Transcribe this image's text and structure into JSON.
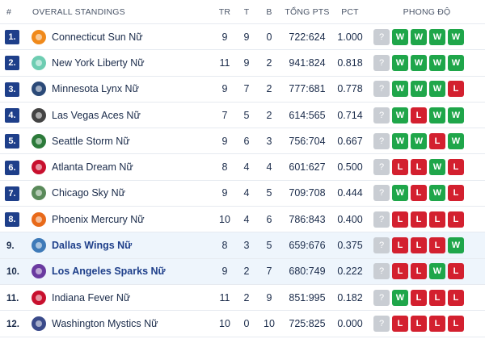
{
  "header": {
    "rank": "#",
    "standings": "OVERALL STANDINGS",
    "tr": "TR",
    "t": "T",
    "b": "B",
    "pts": "TỔNG PTS",
    "pct": "PCT",
    "form": "PHONG ĐỘ"
  },
  "colors": {
    "accent": "#1e3f8a",
    "win": "#1fa64a",
    "loss": "#d3202f",
    "unknown": "#c9cdd3",
    "highlight_row": "#eef5fc"
  },
  "rows": [
    {
      "rank": "1.",
      "team": "Connecticut Sun Nữ",
      "tr": "9",
      "t": "9",
      "b": "0",
      "pts": "722:624",
      "pct": "1.000",
      "form": [
        "?",
        "W",
        "W",
        "W",
        "W"
      ],
      "logo": "connecticut-sun-logo",
      "logo_color": "#f08a1c",
      "highlighted": false
    },
    {
      "rank": "2.",
      "team": "New York Liberty Nữ",
      "tr": "11",
      "t": "9",
      "b": "2",
      "pts": "941:824",
      "pct": "0.818",
      "form": [
        "?",
        "W",
        "W",
        "W",
        "W"
      ],
      "logo": "new-york-liberty-logo",
      "logo_color": "#6ecdb2",
      "highlighted": false
    },
    {
      "rank": "3.",
      "team": "Minnesota Lynx Nữ",
      "tr": "9",
      "t": "7",
      "b": "2",
      "pts": "777:681",
      "pct": "0.778",
      "form": [
        "?",
        "W",
        "W",
        "W",
        "L"
      ],
      "logo": "minnesota-lynx-logo",
      "logo_color": "#2b4a78",
      "highlighted": false
    },
    {
      "rank": "4.",
      "team": "Las Vegas Aces Nữ",
      "tr": "7",
      "t": "5",
      "b": "2",
      "pts": "614:565",
      "pct": "0.714",
      "form": [
        "?",
        "W",
        "L",
        "W",
        "W"
      ],
      "logo": "las-vegas-aces-logo",
      "logo_color": "#444444",
      "highlighted": false
    },
    {
      "rank": "5.",
      "team": "Seattle Storm Nữ",
      "tr": "9",
      "t": "6",
      "b": "3",
      "pts": "756:704",
      "pct": "0.667",
      "form": [
        "?",
        "W",
        "W",
        "L",
        "W"
      ],
      "logo": "seattle-storm-logo",
      "logo_color": "#2c7a3a",
      "highlighted": false
    },
    {
      "rank": "6.",
      "team": "Atlanta Dream Nữ",
      "tr": "8",
      "t": "4",
      "b": "4",
      "pts": "601:627",
      "pct": "0.500",
      "form": [
        "?",
        "L",
        "L",
        "W",
        "L"
      ],
      "logo": "atlanta-dream-logo",
      "logo_color": "#c8102e",
      "highlighted": false
    },
    {
      "rank": "7.",
      "team": "Chicago Sky Nữ",
      "tr": "9",
      "t": "4",
      "b": "5",
      "pts": "709:708",
      "pct": "0.444",
      "form": [
        "?",
        "W",
        "L",
        "W",
        "L"
      ],
      "logo": "chicago-sky-logo",
      "logo_color": "#5a8a5a",
      "highlighted": false
    },
    {
      "rank": "8.",
      "team": "Phoenix Mercury Nữ",
      "tr": "10",
      "t": "4",
      "b": "6",
      "pts": "786:843",
      "pct": "0.400",
      "form": [
        "?",
        "L",
        "L",
        "L",
        "L"
      ],
      "logo": "phoenix-mercury-logo",
      "logo_color": "#e86a1a",
      "highlighted": false
    },
    {
      "rank": "9.",
      "team": "Dallas Wings Nữ",
      "tr": "8",
      "t": "3",
      "b": "5",
      "pts": "659:676",
      "pct": "0.375",
      "form": [
        "?",
        "L",
        "L",
        "L",
        "W"
      ],
      "logo": "dallas-wings-logo",
      "logo_color": "#3e7ab8",
      "highlighted": true
    },
    {
      "rank": "10.",
      "team": "Los Angeles Sparks Nữ",
      "tr": "9",
      "t": "2",
      "b": "7",
      "pts": "680:749",
      "pct": "0.222",
      "form": [
        "?",
        "L",
        "L",
        "W",
        "L"
      ],
      "logo": "los-angeles-sparks-logo",
      "logo_color": "#6a3aa0",
      "highlighted": true
    },
    {
      "rank": "11.",
      "team": "Indiana Fever Nữ",
      "tr": "11",
      "t": "2",
      "b": "9",
      "pts": "851:995",
      "pct": "0.182",
      "form": [
        "?",
        "W",
        "L",
        "L",
        "L"
      ],
      "logo": "indiana-fever-logo",
      "logo_color": "#c8102e",
      "highlighted": false
    },
    {
      "rank": "12.",
      "team": "Washington Mystics Nữ",
      "tr": "10",
      "t": "0",
      "b": "10",
      "pts": "725:825",
      "pct": "0.000",
      "form": [
        "?",
        "L",
        "L",
        "L",
        "L"
      ],
      "logo": "washington-mystics-logo",
      "logo_color": "#3a4a8a",
      "highlighted": false
    }
  ]
}
